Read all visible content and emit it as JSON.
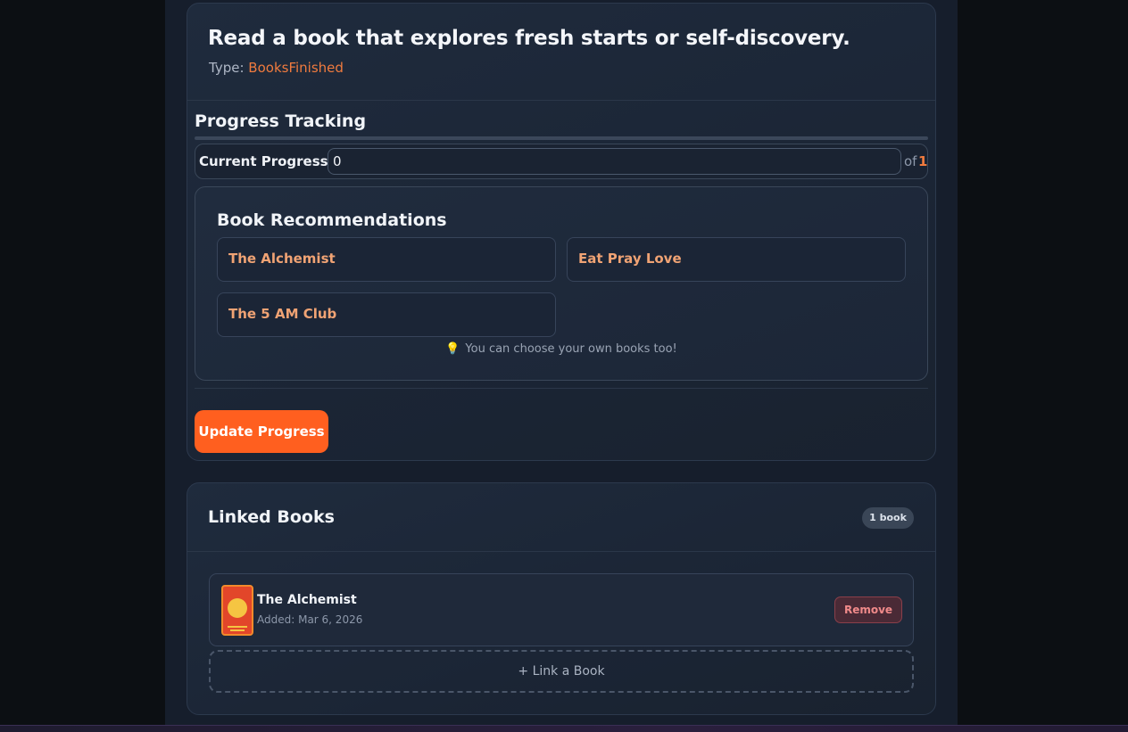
{
  "goal": {
    "title": "Read a book that explores fresh starts or self-discovery.",
    "type_label": "Type:",
    "type_value": "BooksFinished"
  },
  "progress": {
    "section_title": "Progress Tracking",
    "bar_fraction": 0,
    "current_label": "Current Progress:",
    "current_value": "0",
    "of_label": "of",
    "target_value": "1"
  },
  "recommendations": {
    "title": "Book Recommendations",
    "books": [
      "The Alchemist",
      "Eat Pray Love",
      "The 5 AM Club"
    ],
    "hint": "You can choose your own books too!"
  },
  "actions": {
    "update_label": "Update Progress"
  },
  "linked_books": {
    "title": "Linked Books",
    "count_label": "1 book",
    "items": [
      {
        "title": "The Alchemist",
        "added": "Added: Mar 6, 2026",
        "remove_label": "Remove"
      }
    ],
    "link_button_label": "+ Link a Book"
  },
  "colors": {
    "accent": "#ff5f1f",
    "type_value": "#f07b3e",
    "recommendation_link": "#f0a374",
    "danger": "#f08a8a"
  },
  "icons": {
    "hint_icon": "lightbulb-icon"
  }
}
